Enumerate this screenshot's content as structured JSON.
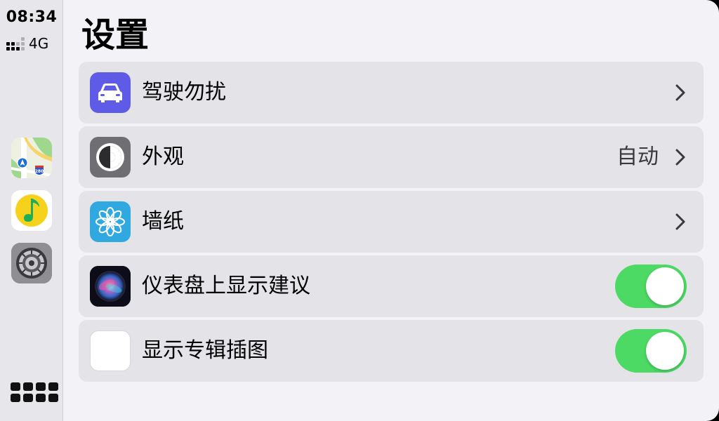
{
  "status": {
    "time": "08:34",
    "network": "4G"
  },
  "dock": {
    "apps": [
      {
        "icon": "maps-icon"
      },
      {
        "icon": "qq-music-icon"
      },
      {
        "icon": "settings-icon"
      }
    ],
    "home_icon": "app-grid-icon"
  },
  "page": {
    "title": "设置"
  },
  "settings": {
    "rows": [
      {
        "label": "驾驶勿扰",
        "icon": "car-icon",
        "accessory": "chevron"
      },
      {
        "label": "外观",
        "value": "自动",
        "icon": "appearance-icon",
        "accessory": "chevron"
      },
      {
        "label": "墙纸",
        "icon": "wallpaper-flower-icon",
        "accessory": "chevron"
      },
      {
        "label": "仪表盘上显示建议",
        "icon": "siri-icon",
        "accessory": "toggle",
        "on": true
      },
      {
        "label": "显示专辑插图",
        "icon": "music-waveform-icon",
        "accessory": "toggle",
        "on": true
      }
    ]
  },
  "colors": {
    "toggle_on": "#4cd964",
    "dnd_icon_bg": "#5e5ce6",
    "wallpaper_icon_bg": "#30a8e0"
  }
}
